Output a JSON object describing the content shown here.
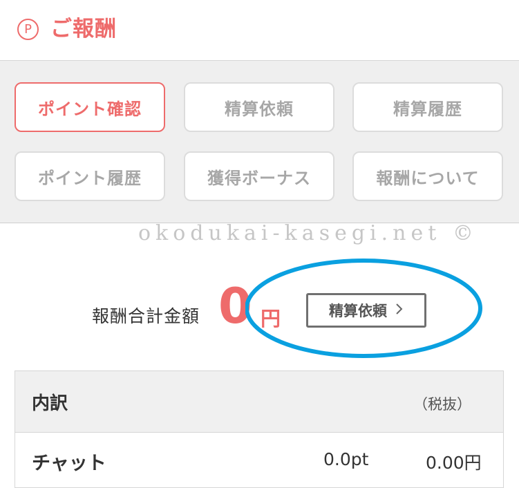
{
  "header": {
    "icon": "point-icon",
    "icon_glyph": "P",
    "title": "ご報酬",
    "accent_color": "#ee6b6b"
  },
  "menu": {
    "items": [
      {
        "label": "ポイント確認",
        "active": true
      },
      {
        "label": "精算依頼",
        "active": false
      },
      {
        "label": "精算履歴",
        "active": false
      },
      {
        "label": "ポイント履歴",
        "active": false
      },
      {
        "label": "獲得ボーナス",
        "active": false
      },
      {
        "label": "報酬について",
        "active": false
      }
    ]
  },
  "watermark": "okodukai-kasegi.net ©",
  "summary": {
    "label": "報酬合計金額",
    "amount": "0",
    "unit": "円",
    "settle_button_label": "精算依頼",
    "settle_button_icon": "chevron-right-icon"
  },
  "annotation": {
    "color": "#0aa0e0",
    "shape": "ellipse"
  },
  "breakdown": {
    "title": "内訳",
    "tax_note": "（税抜）",
    "rows": [
      {
        "label": "チャット",
        "points": "0.0pt",
        "yen": "0.00円"
      }
    ]
  }
}
